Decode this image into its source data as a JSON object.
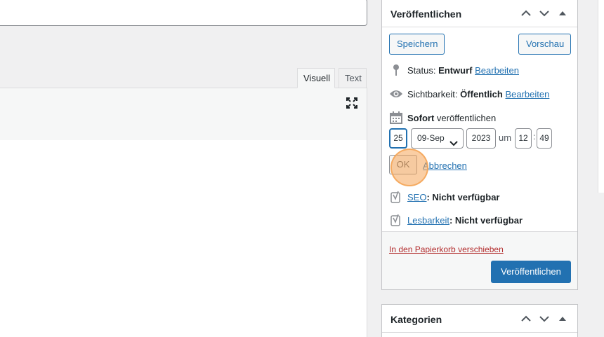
{
  "editor": {
    "tabs": [
      {
        "label": "Visuell",
        "active": true
      },
      {
        "label": "Text",
        "active": false
      }
    ]
  },
  "publish": {
    "title": "Veröffentlichen",
    "save_label": "Speichern",
    "preview_label": "Vorschau",
    "status_label": "Status:",
    "status_value": "Entwurf",
    "status_edit": "Bearbeiten",
    "visibility_label": "Sichtbarkeit:",
    "visibility_value": "Öffentlich",
    "visibility_edit": "Bearbeiten",
    "schedule_strong": "Sofort",
    "schedule_rest": "veröffentlichen",
    "date": {
      "day": "25",
      "month": "09-Sep",
      "year": "2023",
      "at": "um",
      "hour": "12",
      "colon": ":",
      "minute": "49"
    },
    "ok_label": "OK",
    "cancel_label": "Abbrechen",
    "seo_link": "SEO",
    "seo_value": ": Nicht verfügbar",
    "readability_link": "Lesbarkeit",
    "readability_value": ": Nicht verfügbar",
    "trash_label": "In den Papierkorb verschieben",
    "publish_label": "Veröffentlichen"
  },
  "categories": {
    "title": "Kategorien"
  },
  "colors": {
    "accent": "#2271b1",
    "danger": "#b32d2e",
    "click_highlight": "#f5a65a"
  }
}
